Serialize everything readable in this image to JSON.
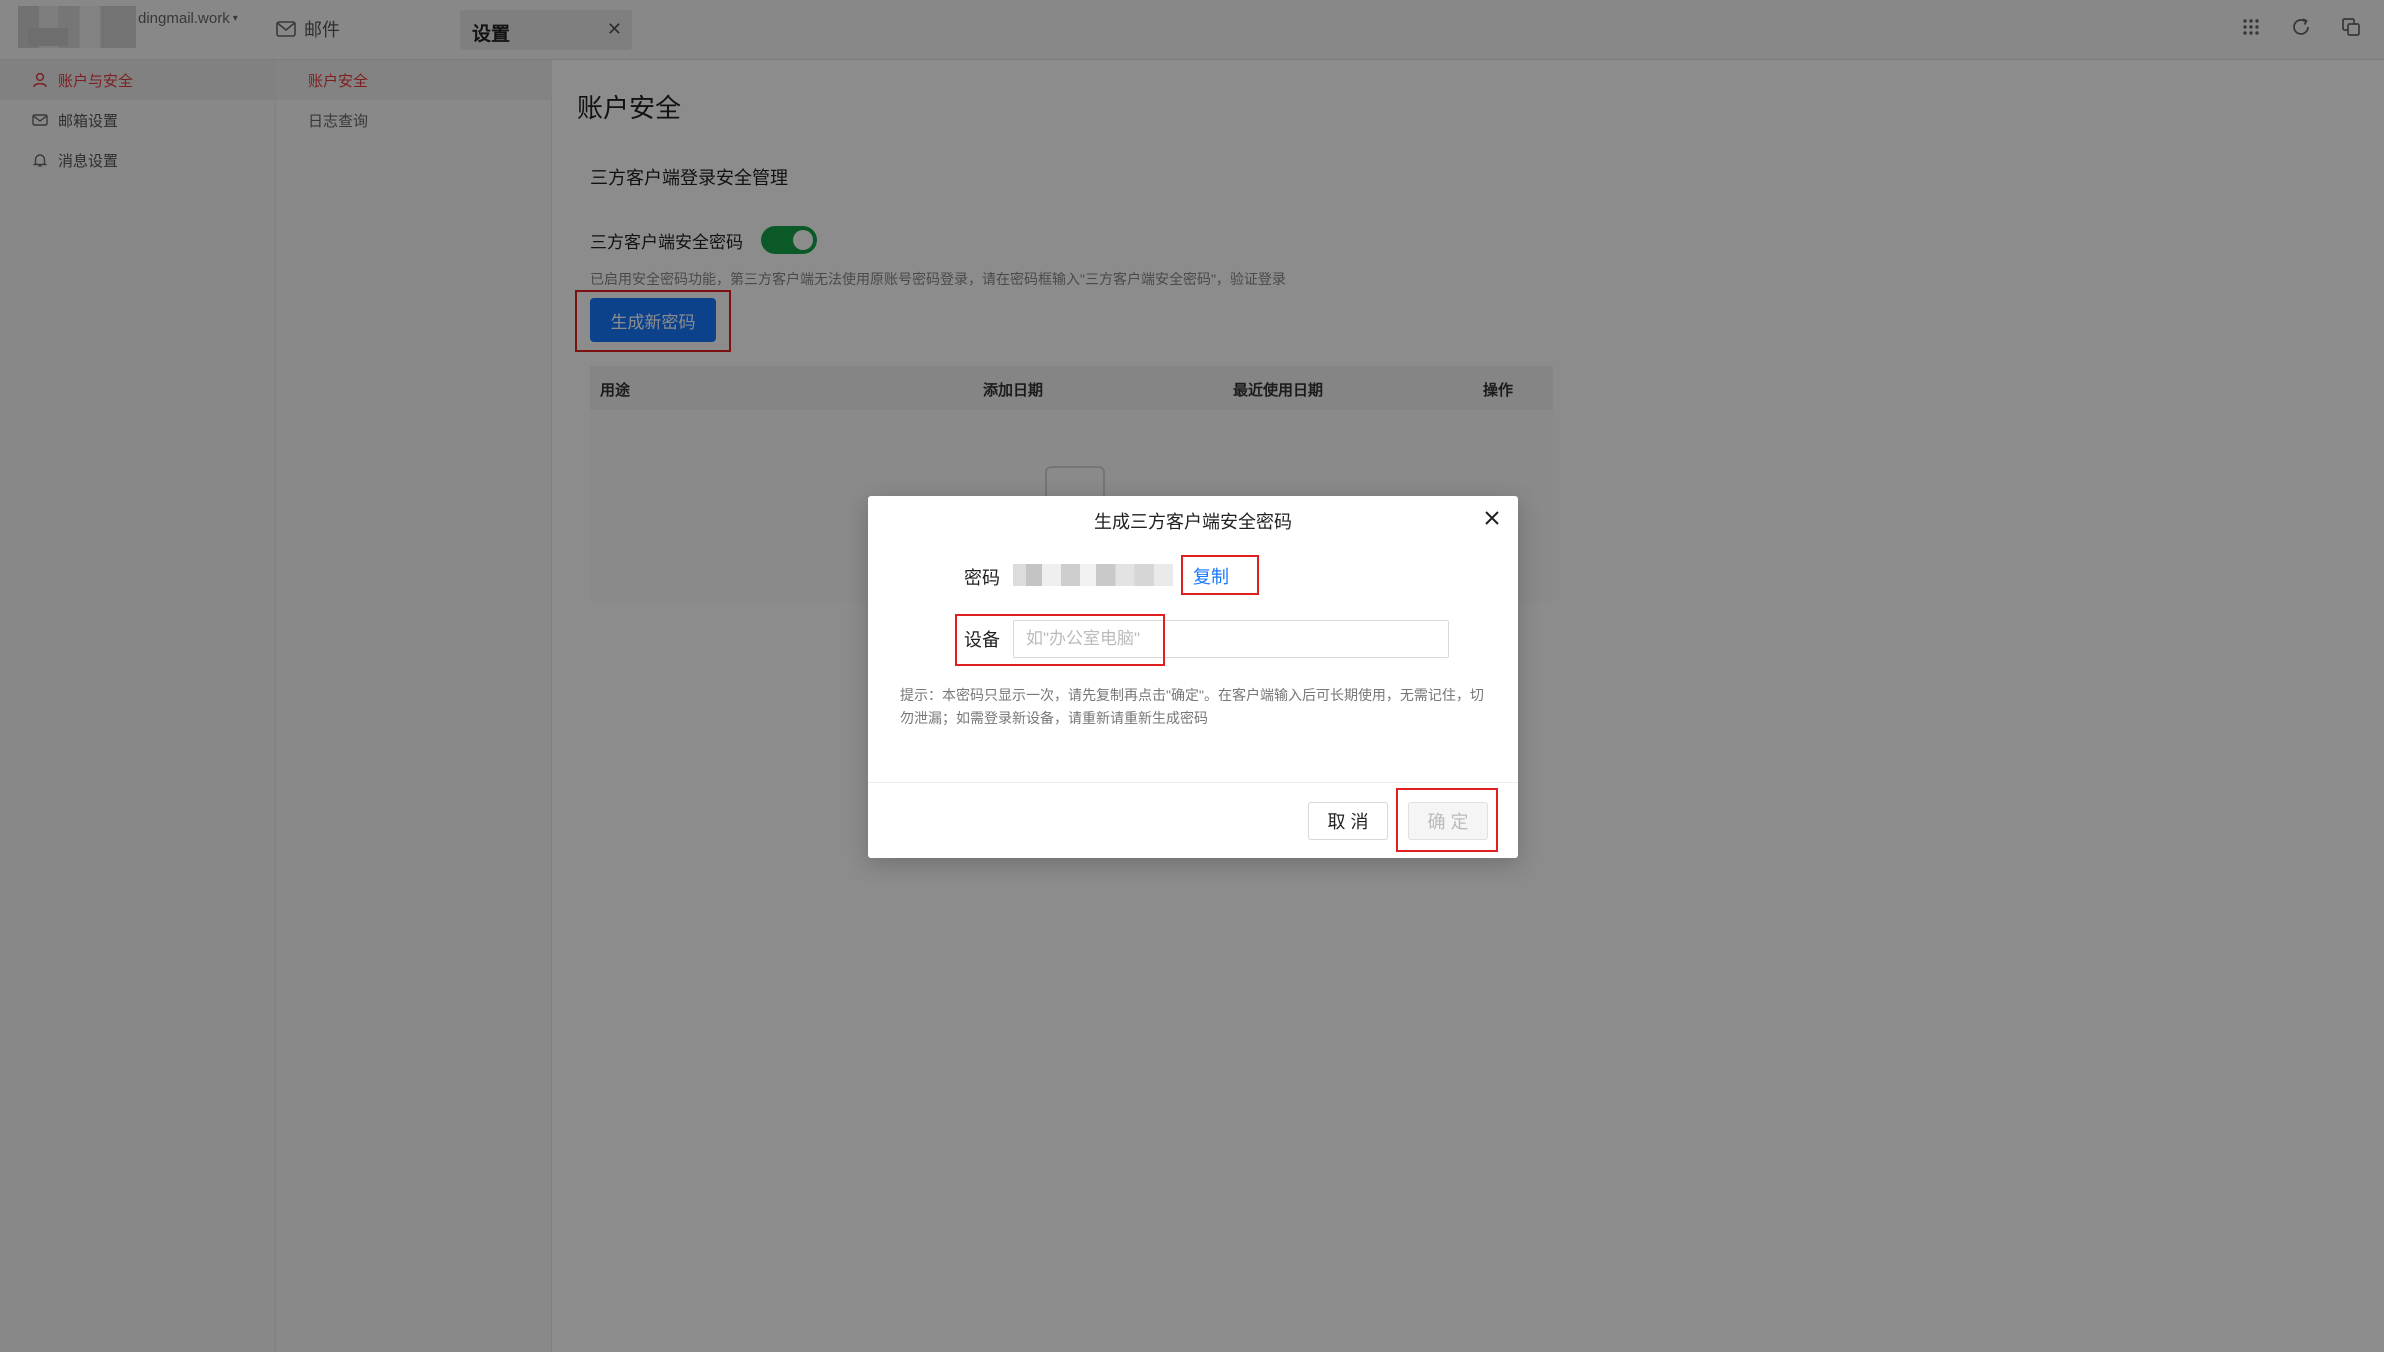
{
  "topbar": {
    "domain": "dingmail.work",
    "domain_caret": "▾",
    "mail_label": "邮件",
    "settings_tab_label": "设置",
    "settings_tab_close": "✕"
  },
  "sidebar": {
    "items": [
      {
        "label": "账户与安全",
        "icon": "user-icon",
        "active": true
      },
      {
        "label": "邮箱设置",
        "icon": "mail-icon",
        "active": false
      },
      {
        "label": "消息设置",
        "icon": "bell-icon",
        "active": false
      }
    ]
  },
  "subsidebar": {
    "items": [
      {
        "label": "账户安全",
        "active": true
      },
      {
        "label": "日志查询",
        "active": false
      }
    ]
  },
  "main": {
    "page_title": "账户安全",
    "section_title": "三方客户端登录安全管理",
    "toggle_label": "三方客户端安全密码",
    "toggle_on": true,
    "hint": "已启用安全密码功能，第三方客户端无法使用原账号密码登录，请在密码框输入\"三方客户端安全密码\"，验证登录",
    "generate_button": "生成新密码",
    "table_headers": [
      "用途",
      "添加日期",
      "最近使用日期",
      "操作"
    ]
  },
  "modal": {
    "title": "生成三方客户端安全密码",
    "password_label": "密码",
    "copy_label": "复制",
    "device_label": "设备",
    "device_placeholder": "如\"办公室电脑\"",
    "device_value": "",
    "tip": "提示：本密码只显示一次，请先复制再点击\"确定\"。在客户端输入后可长期使用，无需记住，切勿泄漏；如需登录新设备，请重新请重新生成密码",
    "cancel_label": "取 消",
    "ok_label": "确 定"
  },
  "colors": {
    "accent_blue": "#1677ff",
    "active_red": "#e4393c",
    "toggle_green": "#16a34a",
    "highlight_box": "#e02020"
  }
}
